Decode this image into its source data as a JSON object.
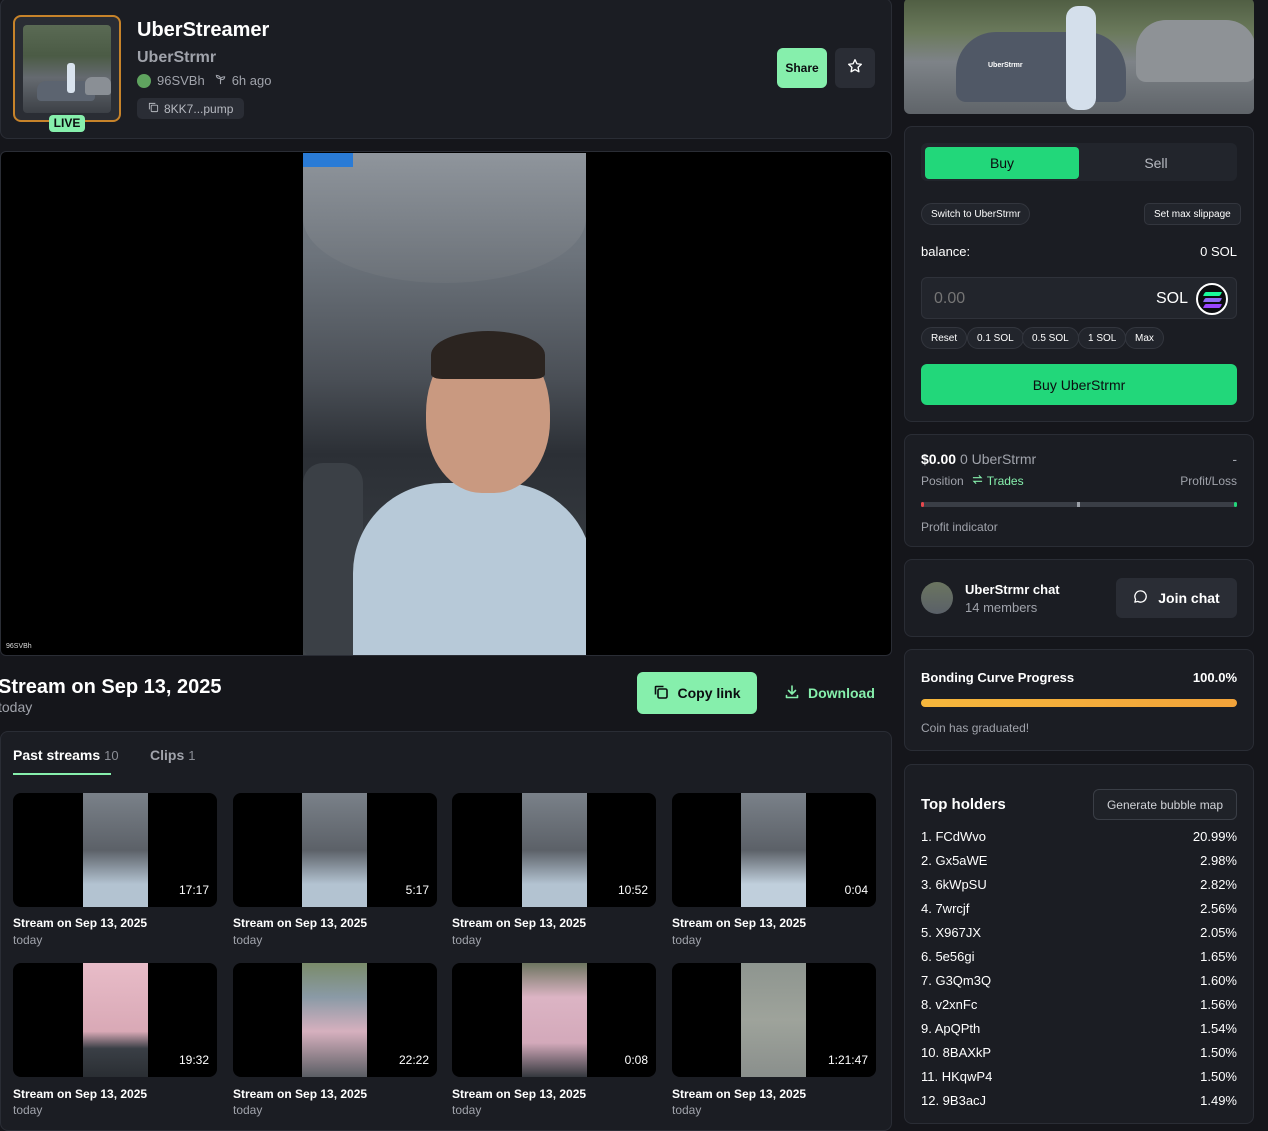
{
  "token": {
    "name": "UberStreamer",
    "ticker": "UberStrmr",
    "creator": "96SVBh",
    "created_ago": "6h ago",
    "contract_address": "8KK7...pump",
    "live_badge": "LIVE"
  },
  "header": {
    "share_label": "Share",
    "favorite_icon": "star-icon"
  },
  "video": {
    "watermark": "96SVBh"
  },
  "stream": {
    "title": "Stream on Sep 13, 2025",
    "subtitle": "today",
    "copy_link_label": "Copy link",
    "download_label": "Download"
  },
  "tabs": [
    {
      "label": "Past streams",
      "count": "10"
    },
    {
      "label": "Clips",
      "count": "1"
    }
  ],
  "past_streams": [
    {
      "title": "Stream on Sep 13, 2025",
      "subtitle": "today",
      "duration": "17:17"
    },
    {
      "title": "Stream on Sep 13, 2025",
      "subtitle": "today",
      "duration": "5:17"
    },
    {
      "title": "Stream on Sep 13, 2025",
      "subtitle": "today",
      "duration": "10:52"
    },
    {
      "title": "Stream on Sep 13, 2025",
      "subtitle": "today",
      "duration": "0:04"
    },
    {
      "title": "Stream on Sep 13, 2025",
      "subtitle": "today",
      "duration": "19:32"
    },
    {
      "title": "Stream on Sep 13, 2025",
      "subtitle": "today",
      "duration": "22:22"
    },
    {
      "title": "Stream on Sep 13, 2025",
      "subtitle": "today",
      "duration": "0:08"
    },
    {
      "title": "Stream on Sep 13, 2025",
      "subtitle": "today",
      "duration": "1:21:47"
    }
  ],
  "cover": {
    "label": "UberStrmr"
  },
  "trade": {
    "buy_tab": "Buy",
    "sell_tab": "Sell",
    "switch_label": "Switch to UberStrmr",
    "slippage_label": "Set max slippage",
    "balance_label": "balance:",
    "balance_value": "0 SOL",
    "amount_placeholder": "0.00",
    "currency": "SOL",
    "quick_amounts": [
      "Reset",
      "0.1 SOL",
      "0.5 SOL",
      "1 SOL",
      "Max"
    ],
    "buy_button": "Buy UberStrmr"
  },
  "position": {
    "value": "$0.00",
    "amount": "0 UberStrmr",
    "pnl": "-",
    "position_label": "Position",
    "trades_label": "Trades",
    "pnl_label": "Profit/Loss",
    "indicator_label": "Profit indicator"
  },
  "chat": {
    "name": "UberStrmr chat",
    "members": "14 members",
    "join_label": "Join chat"
  },
  "bonding_curve": {
    "label": "Bonding Curve Progress",
    "percent_text": "100.0%",
    "progress": 1.0,
    "status": "Coin has graduated!"
  },
  "holders": {
    "title": "Top holders",
    "bubble_map_label": "Generate bubble map",
    "rows": [
      {
        "name": "1. FCdWvo",
        "pct": "20.99%"
      },
      {
        "name": "2. Gx5aWE",
        "pct": "2.98%"
      },
      {
        "name": "3. 6kWpSU",
        "pct": "2.82%"
      },
      {
        "name": "4. 7wrcjf",
        "pct": "2.56%"
      },
      {
        "name": "5. X967JX",
        "pct": "2.05%"
      },
      {
        "name": "6. 5e56gi",
        "pct": "1.65%"
      },
      {
        "name": "7. G3Qm3Q",
        "pct": "1.60%"
      },
      {
        "name": "8. v2xnFc",
        "pct": "1.56%"
      },
      {
        "name": "9. ApQPth",
        "pct": "1.54%"
      },
      {
        "name": "10. 8BAXkP",
        "pct": "1.50%"
      },
      {
        "name": "11. HKqwP4",
        "pct": "1.50%"
      },
      {
        "name": "12. 9B3acJ",
        "pct": "1.49%"
      }
    ]
  },
  "colors": {
    "accent_green": "#86efac",
    "buy_green": "#22d77a",
    "bonding_orange": "#f6b73c",
    "live_border": "#c7832a",
    "background": "#15161b",
    "card": "#1b1d23"
  }
}
